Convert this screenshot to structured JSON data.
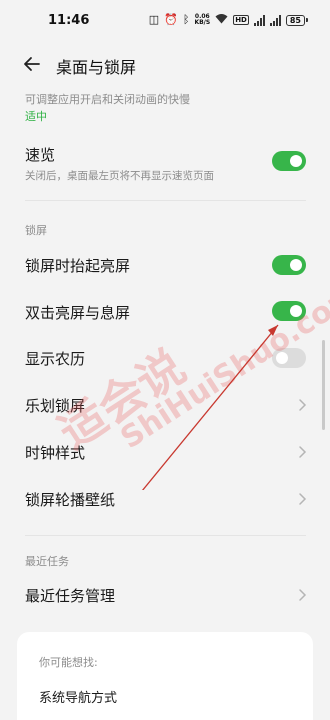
{
  "status_bar": {
    "time": "11:46",
    "net_speed_value": "0.06",
    "net_speed_unit": "KB/S",
    "hd": "HD",
    "battery": "85"
  },
  "header": {
    "title": "桌面与锁屏"
  },
  "top_desc": "可调整应用开启和关闭动画的快慢",
  "top_value": "适中",
  "items": {
    "suolan": {
      "title": "速览",
      "desc": "关闭后，桌面最左页将不再显示速览页面",
      "toggle": true
    }
  },
  "section_lock": "锁屏",
  "lock_items": [
    {
      "title": "锁屏时抬起亮屏",
      "toggle": true
    },
    {
      "title": "双击亮屏与息屏",
      "toggle": true
    },
    {
      "title": "显示农历",
      "toggle": false
    },
    {
      "title": "乐划锁屏"
    },
    {
      "title": "时钟样式"
    },
    {
      "title": "锁屏轮播壁纸"
    }
  ],
  "section_recent": "最近任务",
  "recent_items": [
    {
      "title": "最近任务管理"
    }
  ],
  "suggest_card": {
    "label": "你可能想找:",
    "item": "系统导航方式"
  },
  "watermark": {
    "cn": "适会说",
    "en": "ShiHuiShuo.com"
  },
  "colors": {
    "accent_green": "#37b54a",
    "link_green": "#2fb144",
    "watermark_red": "#e85a5a"
  }
}
